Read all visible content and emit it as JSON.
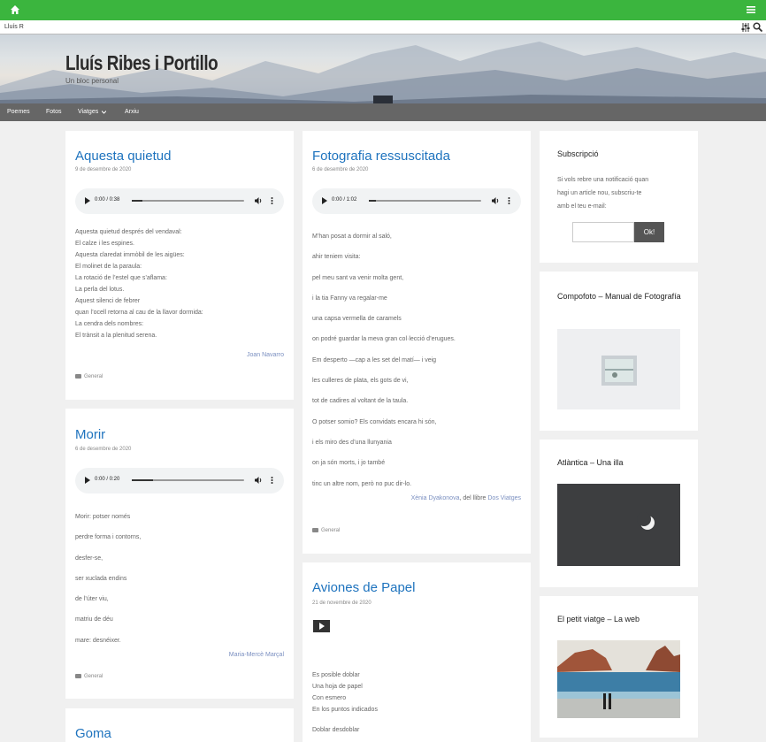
{
  "colors": {
    "topbar": "#3bb53e",
    "nav": "#666666",
    "link": "#1e73be",
    "author": "#7a8fc0"
  },
  "topbar": {
    "home_icon": "home-icon",
    "menu_icon": "hamburger-menu-icon"
  },
  "adminbar": {
    "site_label": "Lluís R",
    "filter_icon": "sliders-icon",
    "search_icon": "search-icon"
  },
  "site": {
    "title": "Lluís Ribes i Portillo",
    "description": "Un bloc personal"
  },
  "nav": {
    "items": [
      {
        "label": "Poemes"
      },
      {
        "label": "Fotos"
      },
      {
        "label": "Viatges"
      },
      {
        "label": "Arxiu"
      }
    ]
  },
  "posts": [
    {
      "title": "Aquesta quietud",
      "date": "9 de desembre de 2020",
      "audio": {
        "time": "0:00 / 0:38"
      },
      "lines": [
        "Aquesta quietud després del vendaval:",
        "El calze i les espines.",
        "Aquesta claredat immòbil de les aigües:",
        "El molinet de la paraula:",
        "La rotació de l’estel que s’aflama:",
        "La perla del lotus.",
        "Aquest silenci de febrer",
        "quan l’ocell retorna al cau de la llavor dormida:",
        "La cendra dels nombres:",
        "El trànsit a la plenitud serena."
      ],
      "author": "Joan Navarro",
      "category": "General"
    },
    {
      "title": "Morir",
      "date": "6 de desembre de 2020",
      "audio": {
        "time": "0:00 / 0:20"
      },
      "lines": [
        "Morir: potser només",
        "perdre forma i contorns,",
        "desfer-se,",
        "ser xuclada endins",
        "de l’úter viu,",
        "matriu de déu",
        "mare: desnéixer."
      ],
      "author": "Maria-Mercè Marçal",
      "category": "General"
    },
    {
      "title": "Goma"
    },
    {
      "title": "Fotografia ressuscitada",
      "date": "6 de desembre de 2020",
      "audio": {
        "time": "0:00 / 1:02"
      },
      "lines": [
        "M’han posat a dormir al saló,",
        "ahir teniem visita:",
        "pel meu sant va venir molta gent,",
        "i la tia Fanny va regalar-me",
        "una capsa vermella de caramels",
        "on podré guardar la meva gran col·lecció d’erugues.",
        "Em desperto —cap a les set del matí— i veig",
        "les culleres de plata, els gots de vi,",
        "tot de cadires al voltant de la taula.",
        "O potser somio? Els convidats encara hi són,",
        "i els miro des d’una llunyania",
        "on ja són morts, i jo també",
        "tinc un altre nom, però no puc dir-lo."
      ],
      "author": "Xènia Dyakonova",
      "author_mid": ", del llibre ",
      "source": "Dos Viatges",
      "category": "General"
    },
    {
      "title": "Aviones de Papel",
      "date": "21 de novembre de 2020",
      "video_icon": "play-video-icon",
      "lines": [
        "Es posible doblar",
        "Una hoja de papel",
        "Con esmero",
        "En los puntos indicados",
        "",
        "Doblar desdoblar"
      ]
    }
  ],
  "widgets": {
    "subscribe": {
      "title": "Subscripció",
      "text": [
        "Si vols rebre una notificació quan",
        "hagi un article nou, subscriu-te",
        "amb el teu e-mail:"
      ],
      "email_placeholder": "",
      "button": "Ok!"
    },
    "links": [
      {
        "title": "Compofoto – Manual de Fotografía"
      },
      {
        "title": "Atlàntica – Una illa"
      },
      {
        "title": "El petit viatge – La web"
      }
    ]
  }
}
